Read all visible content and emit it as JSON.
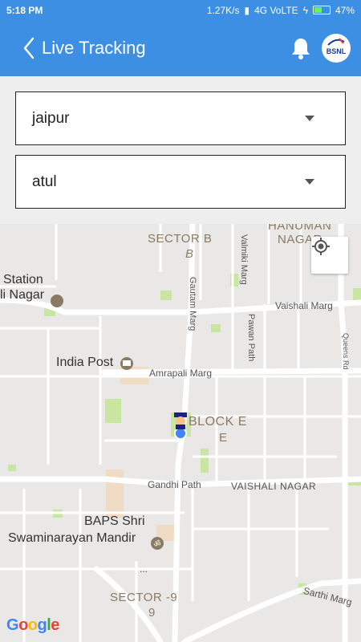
{
  "status_bar": {
    "time": "5:18 PM",
    "network_speed": "1.27K/s",
    "network_type": "4G VoLTE",
    "battery_percent": "47%",
    "battery_level": 0.47
  },
  "header": {
    "title": "Live Tracking",
    "back_icon": "chevron-left-icon",
    "notification_icon": "bell-icon",
    "logo_text": "BSNL"
  },
  "filters": {
    "city": {
      "value": "jaipur"
    },
    "person": {
      "value": "atul"
    }
  },
  "map": {
    "labels": {
      "sector_b": "SECTOR B",
      "sector_b_sub": "B",
      "hanuman_nagar_1": "HANUMAN",
      "hanuman_nagar_2": "NAGAR",
      "station": "Station",
      "nagar": "li Nagar",
      "vaishali_marg": "Vaishali Marg",
      "valmiki_marg": "Valmiki Marg",
      "gautam_marg": "Gautam Marg",
      "pawan_path": "Pawan Path",
      "queens_rd": "Queens Rd",
      "india_post": "India Post",
      "amrapali_marg": "Amrapali Marg",
      "block_e": "BLOCK E",
      "block_e_sub": "E",
      "gandhi_path": "Gandhi Path",
      "vaishali_nagar": "VAISHALI NAGAR",
      "baps_1": "BAPS Shri",
      "baps_2": "Swaminarayan Mandir",
      "sector_9": "SECTOR -9",
      "sector_9_sub": "9",
      "sarthi_marg": "Sarthi Marg",
      "ellipsis": "...",
      "google": "Google"
    },
    "colors": {
      "road": "#ffffff",
      "land": "#e9e8e6",
      "park": "#c8e6a0",
      "accent": "#3d8fe3",
      "location_dot": "#4285f4"
    }
  }
}
